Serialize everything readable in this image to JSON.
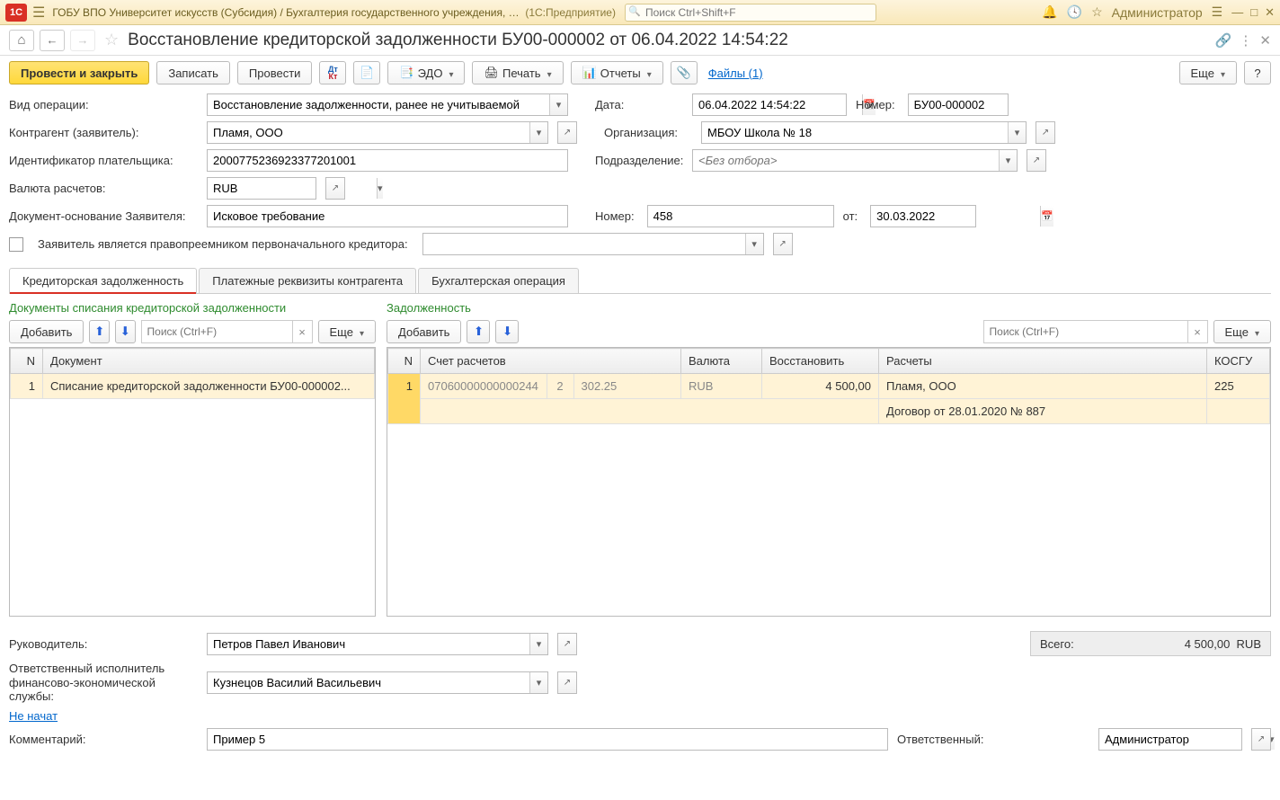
{
  "titlebar": {
    "logo": "1C",
    "title": "ГОБУ ВПО Университет искусств (Субсидия) / Бухгалтерия государственного учреждения, р...",
    "app": "(1С:Предприятие)",
    "search_placeholder": "Поиск Ctrl+Shift+F",
    "admin": "Администратор"
  },
  "page": {
    "title": "Восстановление кредиторской задолженности БУ00-000002 от 06.04.2022 14:54:22"
  },
  "toolbar": {
    "post_close": "Провести и закрыть",
    "save": "Записать",
    "post": "Провести",
    "edo": "ЭДО",
    "print": "Печать",
    "reports": "Отчеты",
    "files": "Файлы (1)",
    "more": "Еще"
  },
  "form": {
    "op_type_label": "Вид операции:",
    "op_type_value": "Восстановление задолженности, ранее не учитываемой",
    "date_label": "Дата:",
    "date_value": "06.04.2022 14:54:22",
    "number_label": "Номер:",
    "number_value": "БУ00-000002",
    "counterparty_label": "Контрагент (заявитель):",
    "counterparty_value": "Пламя, ООО",
    "org_label": "Организация:",
    "org_value": "МБОУ Школа № 18",
    "payer_id_label": "Идентификатор плательщика:",
    "payer_id_value": "2000775236923377201001",
    "division_label": "Подразделение:",
    "division_placeholder": "<Без отбора>",
    "currency_label": "Валюта расчетов:",
    "currency_value": "RUB",
    "basis_label": "Документ-основание Заявителя:",
    "basis_value": "Исковое требование",
    "basis_num_label": "Номер:",
    "basis_num_value": "458",
    "basis_from_label": "от:",
    "basis_date_value": "30.03.2022",
    "successor_label": "Заявитель является правопреемником первоначального кредитора:"
  },
  "tabs": {
    "credit": "Кредиторская задолженность",
    "requisites": "Платежные реквизиты контрагента",
    "accounting": "Бухгалтерская операция"
  },
  "left_panel": {
    "title": "Документы списания кредиторской задолженности",
    "add": "Добавить",
    "search_placeholder": "Поиск (Ctrl+F)",
    "more": "Еще",
    "col_n": "N",
    "col_doc": "Документ",
    "row1_n": "1",
    "row1_doc": "Списание кредиторской задолженности БУ00-000002..."
  },
  "right_panel": {
    "title": "Задолженность",
    "add": "Добавить",
    "search_placeholder": "Поиск (Ctrl+F)",
    "more": "Еще",
    "col_n": "N",
    "col_account": "Счет расчетов",
    "col_currency": "Валюта",
    "col_restore": "Восстановить",
    "col_settlements": "Расчеты",
    "col_kosgu": "КОСГУ",
    "row1_n": "1",
    "row1_acc1": "07060000000000244",
    "row1_acc2": "2",
    "row1_acc3": "302.25",
    "row1_currency": "RUB",
    "row1_restore": "4 500,00",
    "row1_settle1": "Пламя, ООО",
    "row1_settle2": "Договор от 28.01.2020 № 887",
    "row1_kosgu": "225"
  },
  "footer": {
    "head_label": "Руководитель:",
    "head_value": "Петров Павел Иванович",
    "total_label": "Всего:",
    "total_value": "4 500,00",
    "total_currency": "RUB",
    "exec_label": "Ответственный исполнитель финансово-экономической службы:",
    "exec_value": "Кузнецов Василий Васильевич",
    "not_started": "Не начат",
    "comment_label": "Комментарий:",
    "comment_value": "Пример 5",
    "responsible_label": "Ответственный:",
    "responsible_value": "Администратор"
  }
}
